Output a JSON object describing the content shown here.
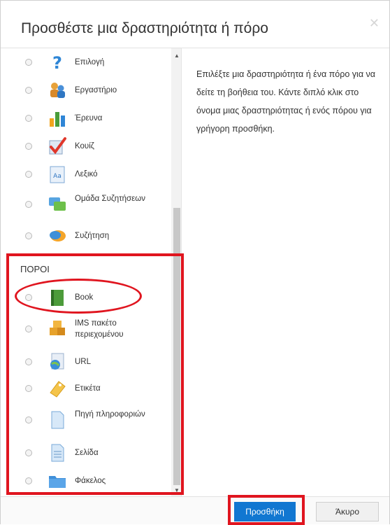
{
  "dialog": {
    "title": "Προσθέστε μια δραστηριότητα ή πόρο",
    "help_text": "Επιλέξτε μια δραστηριότητα ή ένα πόρο για να δείτε τη βοήθεια του. Κάντε διπλό κλικ στο όνομα μιας δραστηριότητας ή ενός πόρου για γρήγορη προσθήκη."
  },
  "activities": [
    {
      "label": "Επιλογή",
      "icon": "question-icon"
    },
    {
      "label": "Εργαστήριο",
      "icon": "workshop-icon"
    },
    {
      "label": "Έρευνα",
      "icon": "survey-chart-icon"
    },
    {
      "label": "Κουίζ",
      "icon": "quiz-check-icon"
    },
    {
      "label": "Λεξικό",
      "icon": "glossary-icon"
    },
    {
      "label": "Ομάδα Συζητήσεων",
      "icon": "forum-icon"
    },
    {
      "label": "Συζήτηση",
      "icon": "chat-icon"
    }
  ],
  "resources_section": {
    "label": "ΠΟΡΟΙ"
  },
  "resources": [
    {
      "label": "Book",
      "icon": "book-icon"
    },
    {
      "label": "IMS πακέτο περιεχομένου",
      "icon": "package-icon"
    },
    {
      "label": "URL",
      "icon": "url-globe-icon"
    },
    {
      "label": "Ετικέτα",
      "icon": "label-tag-icon"
    },
    {
      "label": "Πηγή πληροφοριών",
      "icon": "file-icon"
    },
    {
      "label": "Σελίδα",
      "icon": "page-icon"
    },
    {
      "label": "Φάκελος",
      "icon": "folder-icon"
    }
  ],
  "footer": {
    "add_label": "Προσθήκη",
    "cancel_label": "Άκυρο"
  },
  "colors": {
    "accent": "#1177d1",
    "highlight": "#e0151f"
  }
}
